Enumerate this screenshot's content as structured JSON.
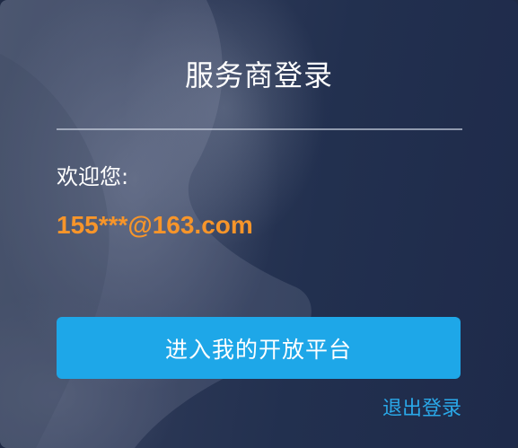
{
  "dialog": {
    "title": "服务商登录",
    "welcome_label": "欢迎您:",
    "account": "155***@163.com",
    "enter_button_label": "进入我的开放平台",
    "logout_link_label": "退出登录"
  },
  "colors": {
    "accent_button": "#1ea7e8",
    "account_text": "#f7952a",
    "link": "#2aa8e8"
  }
}
